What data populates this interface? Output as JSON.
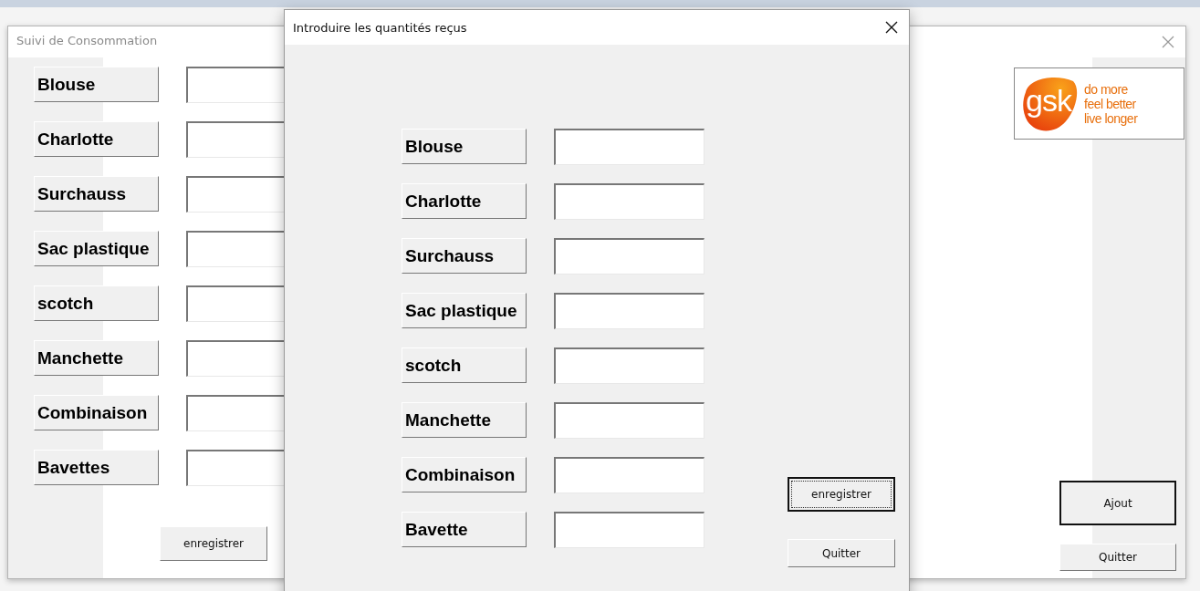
{
  "back_window": {
    "title": "Suivi de Consommation",
    "items": [
      {
        "label": "Blouse",
        "value": ""
      },
      {
        "label": "Charlotte",
        "value": ""
      },
      {
        "label": "Surchauss",
        "value": ""
      },
      {
        "label": "Sac plastique",
        "value": ""
      },
      {
        "label": "scotch",
        "value": ""
      },
      {
        "label": "Manchette",
        "value": ""
      },
      {
        "label": "Combinaison",
        "value": ""
      },
      {
        "label": "Bavettes",
        "value": ""
      }
    ],
    "save_button": {
      "label": "enregistrer"
    },
    "logo": {
      "mark": "gsk",
      "tagline": [
        "do more",
        "feel better",
        "live longer"
      ]
    },
    "add_button": {
      "label": "Ajout",
      "default": true
    },
    "quit_button": {
      "label": "Quitter",
      "default": false
    }
  },
  "dialog": {
    "title": "Introduire les quantités reçus",
    "items": [
      {
        "label": "Blouse",
        "value": ""
      },
      {
        "label": "Charlotte",
        "value": ""
      },
      {
        "label": "Surchauss",
        "value": ""
      },
      {
        "label": "Sac plastique",
        "value": ""
      },
      {
        "label": "scotch",
        "value": ""
      },
      {
        "label": "Manchette",
        "value": ""
      },
      {
        "label": "Combinaison",
        "value": ""
      },
      {
        "label": "Bavette",
        "value": ""
      }
    ],
    "save_button": {
      "label": "enregistrer",
      "focused": true
    },
    "quit_button": {
      "label": "Quitter",
      "focused": false
    }
  }
}
